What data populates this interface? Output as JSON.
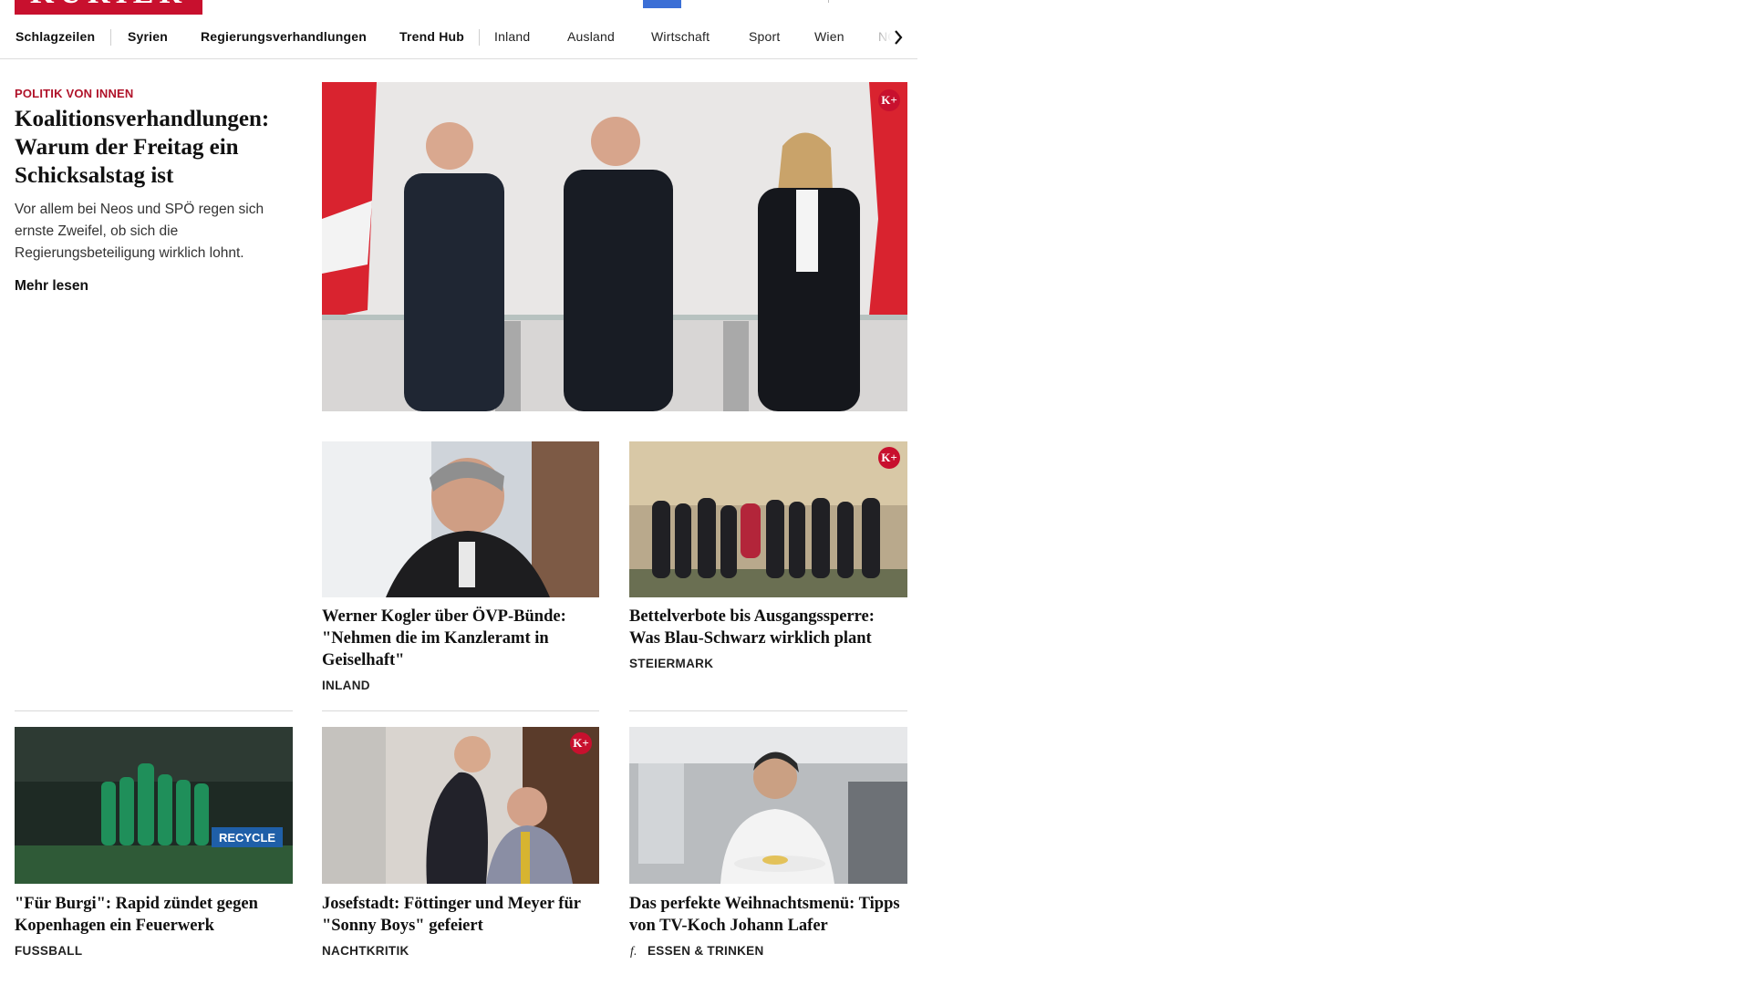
{
  "brand": {
    "logo_text": "KURIER",
    "color": "#c8102e"
  },
  "nav": {
    "items": [
      "Schlagzeilen",
      "Syrien",
      "Regierungsverhandlungen",
      "Trend Hub",
      "Inland",
      "Ausland",
      "Wirtschaft",
      "Sport",
      "Wien",
      "NÖ"
    ],
    "next_icon": "chevron-right-icon"
  },
  "lead": {
    "kicker": "POLITIK VON INNEN",
    "title": "Koalitionsverhandlungen: Warum der Freitag ein Schicksalstag ist",
    "teaser": "Vor allem bei Neos und SPÖ regen sich ernste Zweifel, ob sich die Regierungsbeteiligung wirklich lohnt.",
    "more": "Mehr lesen",
    "badge": "K+"
  },
  "cards": [
    {
      "title": "Werner Kogler über ÖVP-Bünde: \"Nehmen die im Kanzleramt in Geiselhaft\"",
      "category": "INLAND",
      "badge": ""
    },
    {
      "title": "Bettelverbote bis Ausgangssperre: Was Blau-Schwarz wirklich plant",
      "category": "STEIERMARK",
      "badge": "K+"
    },
    {
      "title": "\"Für Burgi\": Rapid zündet gegen Kopenhagen ein Feuerwerk",
      "category": "FUSSBALL",
      "badge": "",
      "image_text": "RECYCLE"
    },
    {
      "title": "Josefstadt: Föttinger und Meyer für \"Sonny Boys\" gefeiert",
      "category": "NACHTKRITIK",
      "badge": "K+"
    },
    {
      "title": "Das perfekte Weihnachtsmenü: Tipps von TV-Koch Johann Lafer",
      "category": "ESSEN & TRINKEN",
      "badge": "",
      "category_icon": "f."
    }
  ]
}
